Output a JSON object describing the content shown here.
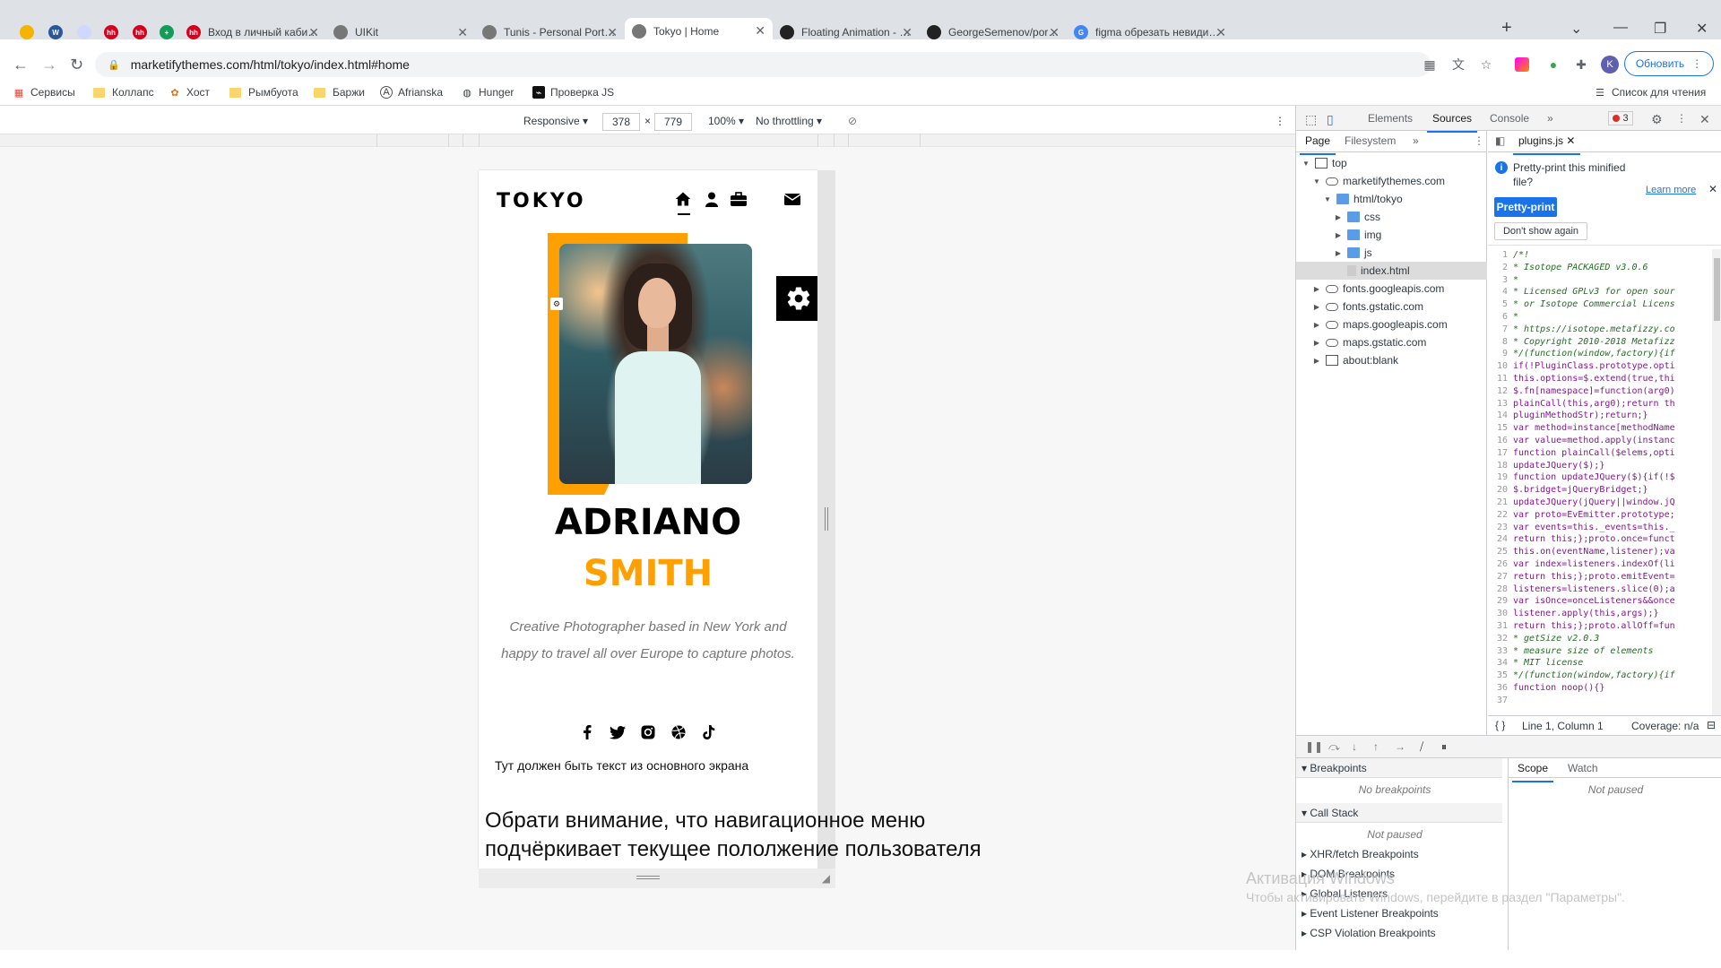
{
  "browser": {
    "tabs": [
      {
        "title": "",
        "icon": "sun-icon",
        "color": "#f4b400"
      },
      {
        "title": "",
        "icon": "word-icon",
        "color": "#2b579a",
        "glyph": "W"
      },
      {
        "title": "",
        "icon": "loading-icon",
        "color": "#cfd8ff"
      },
      {
        "title": "",
        "icon": "hh-icon",
        "color": "#d6001c",
        "glyph": "hh"
      },
      {
        "title": "",
        "icon": "hh-icon",
        "color": "#d6001c",
        "glyph": "hh"
      },
      {
        "title": "",
        "icon": "sheets-icon",
        "color": "#0f9d58",
        "glyph": "+"
      },
      {
        "title": "Вход в личный кабинет",
        "icon": "hh-icon",
        "color": "#d6001c",
        "glyph": "hh"
      },
      {
        "title": "UIKit",
        "icon": "globe-icon",
        "color": "#777777"
      },
      {
        "title": "Tunis - Personal Portfolio",
        "icon": "globe-icon",
        "color": "#777777"
      },
      {
        "title": "Tokyo | Home",
        "icon": "globe-icon",
        "color": "#777777"
      },
      {
        "title": "Floating Animation - CSS",
        "icon": "codepen-icon",
        "color": "#222222"
      },
      {
        "title": "GeorgeSemenov/portfolio",
        "icon": "github-icon",
        "color": "#222222"
      },
      {
        "title": "figma обрезать невидимое",
        "icon": "google-icon",
        "color": "#4285f4",
        "glyph": "G"
      }
    ],
    "url": "marketifythemes.com/html/tokyo/index.html#home",
    "update_label": "Обновить",
    "profile_initial": "K",
    "bookmarks": [
      "Сервисы",
      "Коллапс",
      "Хост",
      "Рымбуота",
      "Баржи",
      "Afrianska",
      "Hunger",
      "Проверка JS"
    ],
    "reading_list": "Список для чтения"
  },
  "device_toolbar": {
    "mode": "Responsive",
    "width": "378",
    "height": "779",
    "zoom": "100%",
    "throttling": "No throttling",
    "times": "×"
  },
  "site": {
    "logo": "TOKYO",
    "first_name": "ADRIANO",
    "last_name": "SMITH",
    "bio": "Creative Photographer based in New York and happy to travel all over Europe to capture photos.",
    "note": "Тут должен быть текст из основного экрана",
    "accent": "#ff9f00"
  },
  "overlay_note": {
    "line1": "Обрати внимание, что навигационное меню",
    "line2": "подчёркивает текущее пололжение пользователя"
  },
  "devtools": {
    "tabs": [
      "Elements",
      "Sources",
      "Console"
    ],
    "active_tab": "Sources",
    "error_count": "3",
    "nav_tabs": [
      "Page",
      "Filesystem"
    ],
    "tree": [
      {
        "label": "top",
        "indent": 0,
        "kind": "frame",
        "caret": "▼"
      },
      {
        "label": "marketifythemes.com",
        "indent": 1,
        "kind": "cloud",
        "caret": "▼"
      },
      {
        "label": "html/tokyo",
        "indent": 2,
        "kind": "folder",
        "caret": "▼"
      },
      {
        "label": "css",
        "indent": 3,
        "kind": "folder",
        "caret": "▶"
      },
      {
        "label": "img",
        "indent": 3,
        "kind": "folder",
        "caret": "▶"
      },
      {
        "label": "js",
        "indent": 3,
        "kind": "folder",
        "caret": "▶"
      },
      {
        "label": "index.html",
        "indent": 3,
        "kind": "file",
        "caret": ""
      },
      {
        "label": "fonts.googleapis.com",
        "indent": 1,
        "kind": "cloud",
        "caret": "▶"
      },
      {
        "label": "fonts.gstatic.com",
        "indent": 1,
        "kind": "cloud",
        "caret": "▶"
      },
      {
        "label": "maps.googleapis.com",
        "indent": 1,
        "kind": "cloud",
        "caret": "▶"
      },
      {
        "label": "maps.gstatic.com",
        "indent": 1,
        "kind": "cloud",
        "caret": "▶"
      },
      {
        "label": "about:blank",
        "indent": 1,
        "kind": "frame",
        "caret": "▶"
      }
    ],
    "open_file": "plugins.js",
    "info_text": "Pretty-print this minified file?",
    "pretty_print": "Pretty-print",
    "learn_more": "Learn more",
    "dont_show": "Don't show again",
    "code": [
      "/*!",
      " * Isotope PACKAGED v3.0.6",
      " *",
      " * Licensed GPLv3 for open sour",
      " * or Isotope Commercial Licens",
      " *",
      " * https://isotope.metafizzy.co",
      " * Copyright 2010-2018 Metafizz",
      " */(function(window,factory){if",
      "if(!PluginClass.prototype.opti",
      "this.options=$.extend(true,thi",
      "$.fn[namespace]=function(arg0)",
      "plainCall(this,arg0);return th",
      "pluginMethodStr);return;}",
      "var method=instance[methodName",
      "var value=method.apply(instanc",
      "function plainCall($elems,opti",
      "updateJQuery($);}",
      "function updateJQuery($){if(!$",
      "$.bridget=jQueryBridget;}",
      "updateJQuery(jQuery||window.jQ",
      "var proto=EvEmitter.prototype;",
      "var events=this._events=this._",
      "return this;};proto.once=funct",
      "this.on(eventName,listener);va",
      "var index=listeners.indexOf(li",
      "return this;};proto.emitEvent=",
      "listeners=listeners.slice(0);a",
      "var isOnce=onceListeners&&once",
      "listener.apply(this,args);}",
      "return this;};proto.allOff=fun",
      " * getSize v2.0.3",
      " * measure size of elements",
      " * MIT license",
      " */(function(window,factory){if",
      "function noop(){}",
      ""
    ],
    "status_pos": "Line 1, Column 1",
    "coverage": "Coverage: n/a",
    "sections": {
      "breakpoints": "Breakpoints",
      "no_breakpoints": "No breakpoints",
      "call_stack": "Call Stack",
      "not_paused": "Not paused",
      "xhr": "XHR/fetch Breakpoints",
      "dom": "DOM Breakpoints",
      "global": "Global Listeners",
      "event": "Event Listener Breakpoints",
      "csp": "CSP Violation Breakpoints"
    },
    "scope_tabs": [
      "Scope",
      "Watch"
    ],
    "scope_empty": "Not paused"
  },
  "watermark": {
    "line1": "Активация Windows",
    "line2": "Чтобы активировать Windows, перейдите в раздел \"Параметры\"."
  }
}
